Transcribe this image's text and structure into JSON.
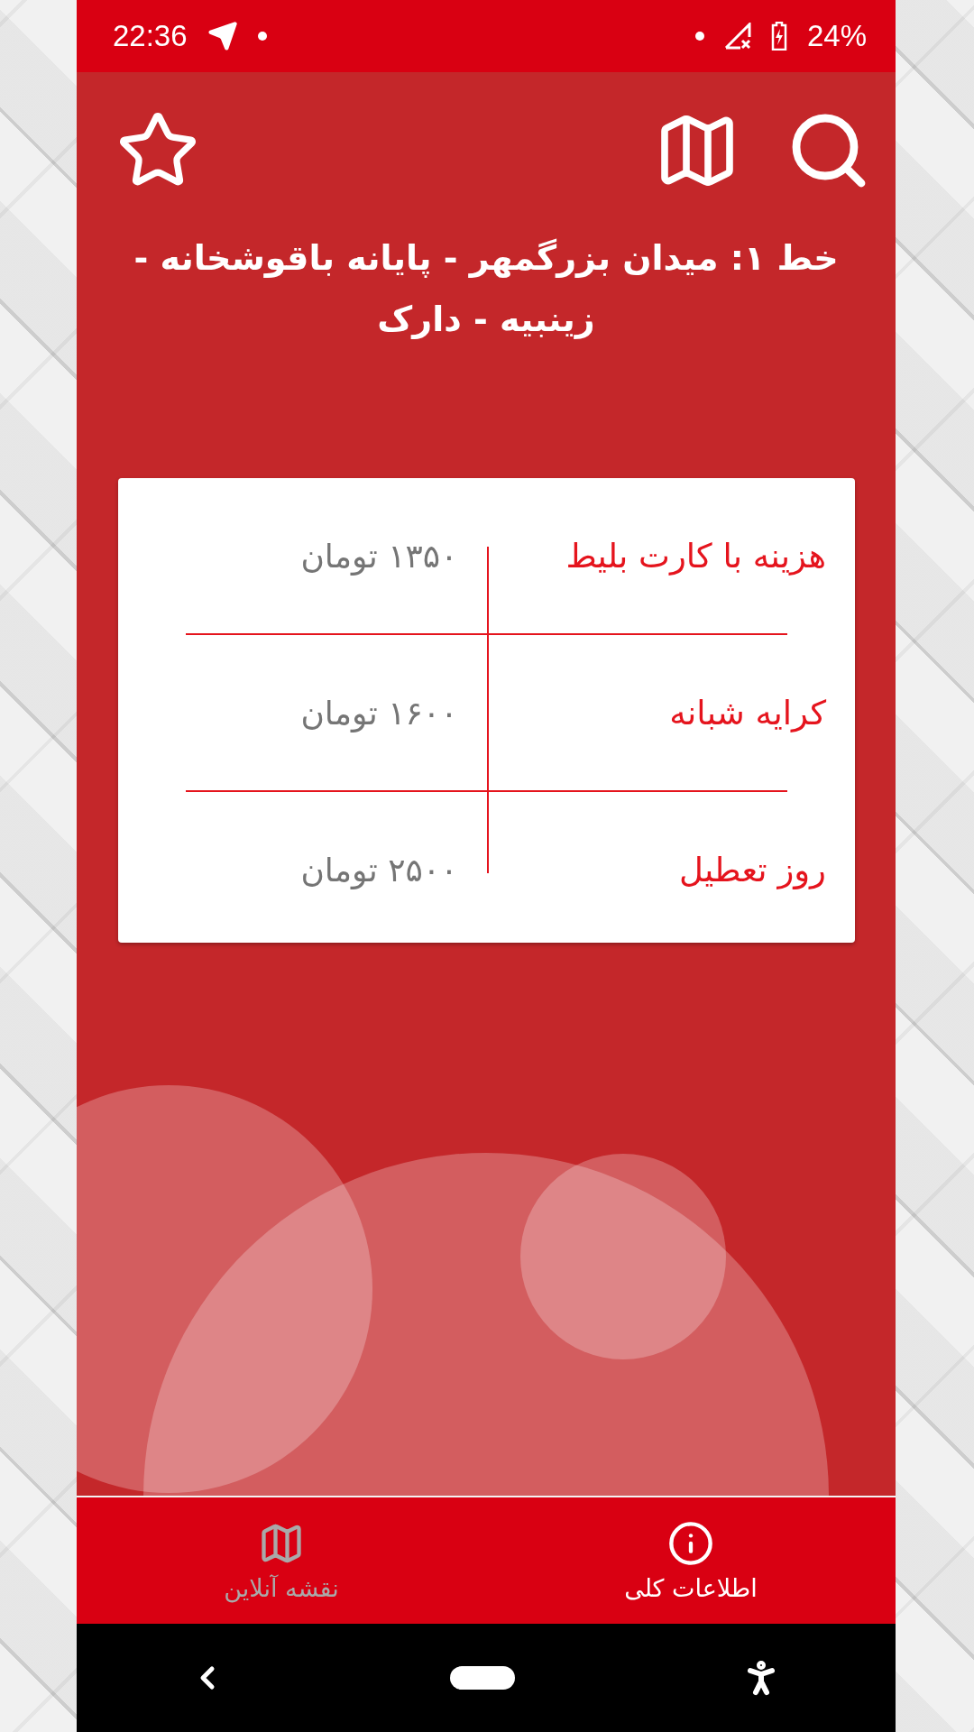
{
  "status_bar": {
    "time": "22:36",
    "battery": "24%"
  },
  "toolbar": {
    "title": "خط ۱: میدان بزرگمهر - پایانه باقوشخانه - زینبیه - دارک"
  },
  "fares": [
    {
      "label": "هزینه با کارت بلیط",
      "value": "۱۳۵۰ تومان"
    },
    {
      "label": "کرایه شبانه",
      "value": "۱۶۰۰ تومان"
    },
    {
      "label": "روز تعطیل",
      "value": "۲۵۰۰ تومان"
    }
  ],
  "bottom_nav": [
    {
      "kind": "info",
      "label": "اطلاعات کلی",
      "selected": true
    },
    {
      "kind": "map",
      "label": "نقشه آنلاین",
      "selected": false
    }
  ]
}
